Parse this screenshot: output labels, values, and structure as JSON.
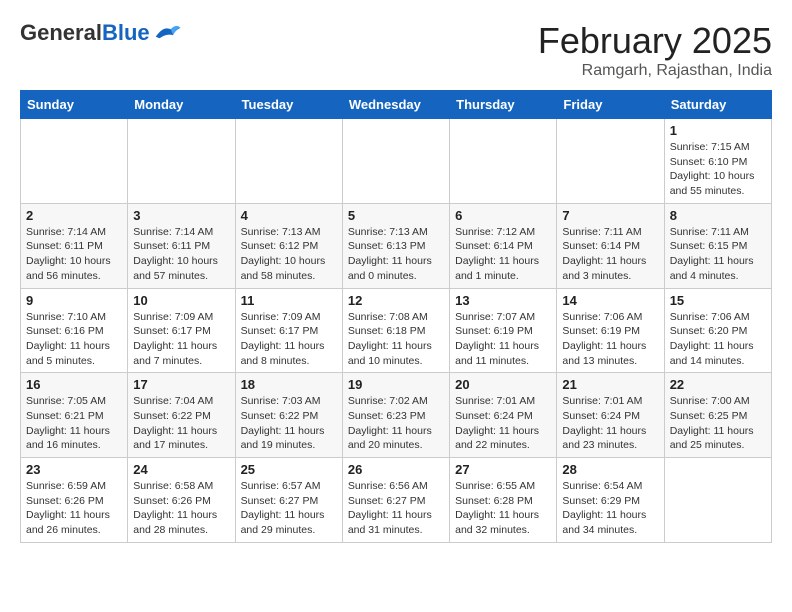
{
  "header": {
    "logo_general": "General",
    "logo_blue": "Blue",
    "month_title": "February 2025",
    "location": "Ramgarh, Rajasthan, India"
  },
  "days_of_week": [
    "Sunday",
    "Monday",
    "Tuesday",
    "Wednesday",
    "Thursday",
    "Friday",
    "Saturday"
  ],
  "weeks": [
    [
      {
        "day": "",
        "info": ""
      },
      {
        "day": "",
        "info": ""
      },
      {
        "day": "",
        "info": ""
      },
      {
        "day": "",
        "info": ""
      },
      {
        "day": "",
        "info": ""
      },
      {
        "day": "",
        "info": ""
      },
      {
        "day": "1",
        "info": "Sunrise: 7:15 AM\nSunset: 6:10 PM\nDaylight: 10 hours\nand 55 minutes."
      }
    ],
    [
      {
        "day": "2",
        "info": "Sunrise: 7:14 AM\nSunset: 6:11 PM\nDaylight: 10 hours\nand 56 minutes."
      },
      {
        "day": "3",
        "info": "Sunrise: 7:14 AM\nSunset: 6:11 PM\nDaylight: 10 hours\nand 57 minutes."
      },
      {
        "day": "4",
        "info": "Sunrise: 7:13 AM\nSunset: 6:12 PM\nDaylight: 10 hours\nand 58 minutes."
      },
      {
        "day": "5",
        "info": "Sunrise: 7:13 AM\nSunset: 6:13 PM\nDaylight: 11 hours\nand 0 minutes."
      },
      {
        "day": "6",
        "info": "Sunrise: 7:12 AM\nSunset: 6:14 PM\nDaylight: 11 hours\nand 1 minute."
      },
      {
        "day": "7",
        "info": "Sunrise: 7:11 AM\nSunset: 6:14 PM\nDaylight: 11 hours\nand 3 minutes."
      },
      {
        "day": "8",
        "info": "Sunrise: 7:11 AM\nSunset: 6:15 PM\nDaylight: 11 hours\nand 4 minutes."
      }
    ],
    [
      {
        "day": "9",
        "info": "Sunrise: 7:10 AM\nSunset: 6:16 PM\nDaylight: 11 hours\nand 5 minutes."
      },
      {
        "day": "10",
        "info": "Sunrise: 7:09 AM\nSunset: 6:17 PM\nDaylight: 11 hours\nand 7 minutes."
      },
      {
        "day": "11",
        "info": "Sunrise: 7:09 AM\nSunset: 6:17 PM\nDaylight: 11 hours\nand 8 minutes."
      },
      {
        "day": "12",
        "info": "Sunrise: 7:08 AM\nSunset: 6:18 PM\nDaylight: 11 hours\nand 10 minutes."
      },
      {
        "day": "13",
        "info": "Sunrise: 7:07 AM\nSunset: 6:19 PM\nDaylight: 11 hours\nand 11 minutes."
      },
      {
        "day": "14",
        "info": "Sunrise: 7:06 AM\nSunset: 6:19 PM\nDaylight: 11 hours\nand 13 minutes."
      },
      {
        "day": "15",
        "info": "Sunrise: 7:06 AM\nSunset: 6:20 PM\nDaylight: 11 hours\nand 14 minutes."
      }
    ],
    [
      {
        "day": "16",
        "info": "Sunrise: 7:05 AM\nSunset: 6:21 PM\nDaylight: 11 hours\nand 16 minutes."
      },
      {
        "day": "17",
        "info": "Sunrise: 7:04 AM\nSunset: 6:22 PM\nDaylight: 11 hours\nand 17 minutes."
      },
      {
        "day": "18",
        "info": "Sunrise: 7:03 AM\nSunset: 6:22 PM\nDaylight: 11 hours\nand 19 minutes."
      },
      {
        "day": "19",
        "info": "Sunrise: 7:02 AM\nSunset: 6:23 PM\nDaylight: 11 hours\nand 20 minutes."
      },
      {
        "day": "20",
        "info": "Sunrise: 7:01 AM\nSunset: 6:24 PM\nDaylight: 11 hours\nand 22 minutes."
      },
      {
        "day": "21",
        "info": "Sunrise: 7:01 AM\nSunset: 6:24 PM\nDaylight: 11 hours\nand 23 minutes."
      },
      {
        "day": "22",
        "info": "Sunrise: 7:00 AM\nSunset: 6:25 PM\nDaylight: 11 hours\nand 25 minutes."
      }
    ],
    [
      {
        "day": "23",
        "info": "Sunrise: 6:59 AM\nSunset: 6:26 PM\nDaylight: 11 hours\nand 26 minutes."
      },
      {
        "day": "24",
        "info": "Sunrise: 6:58 AM\nSunset: 6:26 PM\nDaylight: 11 hours\nand 28 minutes."
      },
      {
        "day": "25",
        "info": "Sunrise: 6:57 AM\nSunset: 6:27 PM\nDaylight: 11 hours\nand 29 minutes."
      },
      {
        "day": "26",
        "info": "Sunrise: 6:56 AM\nSunset: 6:27 PM\nDaylight: 11 hours\nand 31 minutes."
      },
      {
        "day": "27",
        "info": "Sunrise: 6:55 AM\nSunset: 6:28 PM\nDaylight: 11 hours\nand 32 minutes."
      },
      {
        "day": "28",
        "info": "Sunrise: 6:54 AM\nSunset: 6:29 PM\nDaylight: 11 hours\nand 34 minutes."
      },
      {
        "day": "",
        "info": ""
      }
    ]
  ]
}
